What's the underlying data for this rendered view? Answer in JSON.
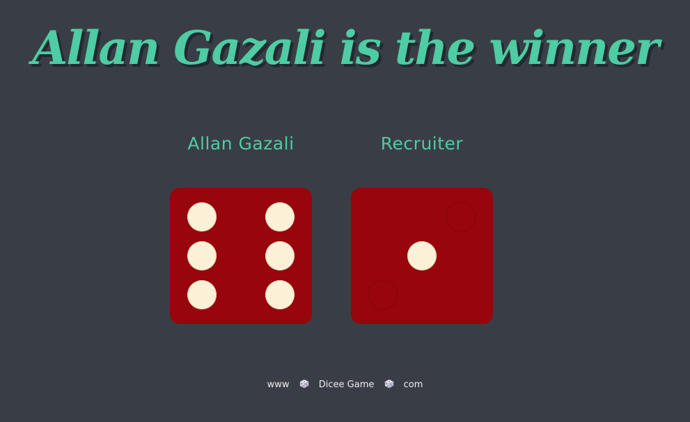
{
  "title": "Allan Gazali is the winner",
  "players": [
    {
      "name": "Allan Gazali",
      "die_value": 6
    },
    {
      "name": "Recruiter",
      "die_value": 1
    }
  ],
  "footer": {
    "prefix": "www",
    "site": "Dicee Game",
    "suffix": "com",
    "icon": "dice-icon"
  },
  "colors": {
    "background": "#393e46",
    "accent": "#4ecca3",
    "die": "#98050c",
    "pip": "#fcf0d6"
  }
}
